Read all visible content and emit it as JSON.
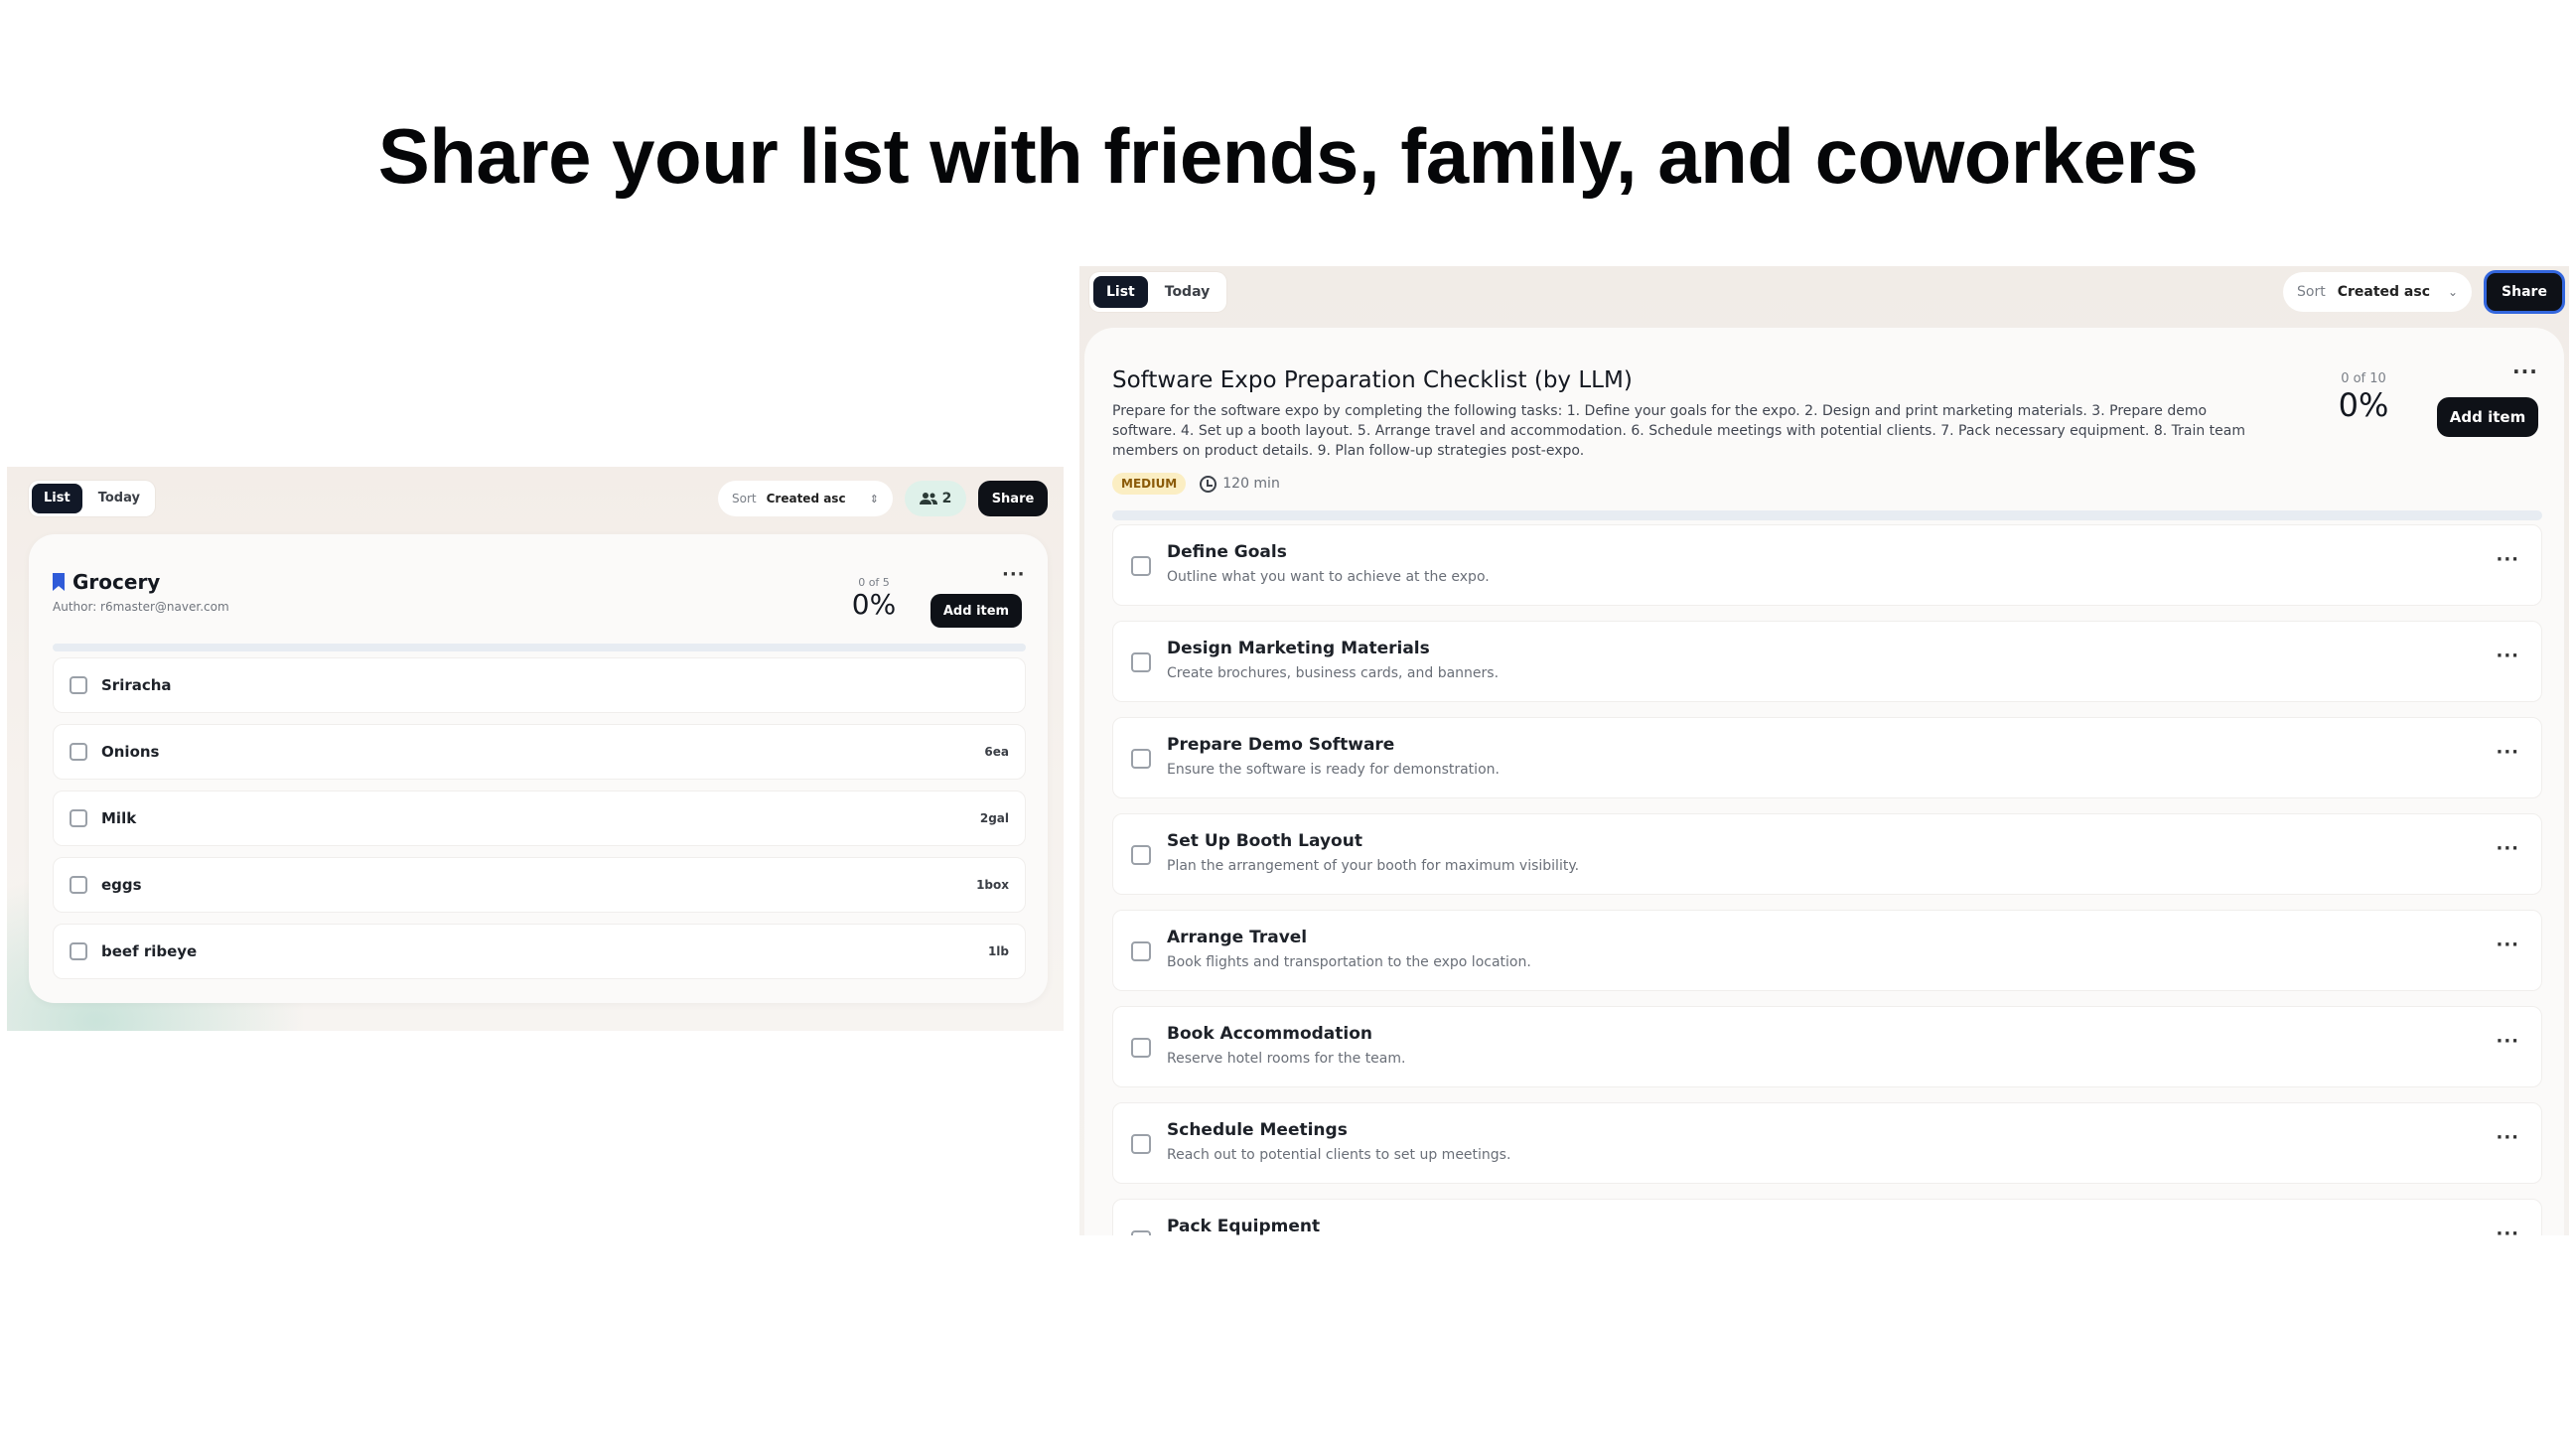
{
  "headline": "Share your list with friends, family, and coworkers",
  "left": {
    "tabs": [
      {
        "label": "List",
        "active": true
      },
      {
        "label": "Today",
        "active": false
      }
    ],
    "sort": {
      "label": "Sort",
      "value": "Created asc"
    },
    "members_count": "2",
    "share_label": "Share",
    "list": {
      "title": "Grocery",
      "author": "Author: r6master@naver.com",
      "progress_count": "0 of 5",
      "progress_percent": "0%",
      "add_item_label": "Add item",
      "more": "···",
      "items": [
        {
          "name": "Sriracha",
          "qty": ""
        },
        {
          "name": "Onions",
          "qty": "6ea"
        },
        {
          "name": "Milk",
          "qty": "2gal"
        },
        {
          "name": "eggs",
          "qty": "1box"
        },
        {
          "name": "beef ribeye",
          "qty": "1lb"
        }
      ]
    }
  },
  "right": {
    "tabs": [
      {
        "label": "List",
        "active": true
      },
      {
        "label": "Today",
        "active": false
      }
    ],
    "sort": {
      "label": "Sort",
      "value": "Created asc"
    },
    "share_label": "Share",
    "list": {
      "title": "Software Expo Preparation Checklist (by LLM)",
      "description": "Prepare for the software expo by completing the following tasks: 1. Define your goals for the expo. 2. Design and print marketing materials. 3. Prepare demo software. 4. Set up a booth layout. 5. Arrange travel and accommodation. 6. Schedule meetings with potential clients. 7. Pack necessary equipment. 8. Train team members on product details. 9. Plan follow-up strategies post-expo.",
      "priority": "MEDIUM",
      "duration": "120 min",
      "progress_count": "0 of 10",
      "progress_percent": "0%",
      "add_item_label": "Add item",
      "more": "···",
      "items": [
        {
          "name": "Define Goals",
          "note": "Outline what you want to achieve at the expo."
        },
        {
          "name": "Design Marketing Materials",
          "note": "Create brochures, business cards, and banners."
        },
        {
          "name": "Prepare Demo Software",
          "note": "Ensure the software is ready for demonstration."
        },
        {
          "name": "Set Up Booth Layout",
          "note": "Plan the arrangement of your booth for maximum visibility."
        },
        {
          "name": "Arrange Travel",
          "note": "Book flights and transportation to the expo location."
        },
        {
          "name": "Book Accommodation",
          "note": "Reserve hotel rooms for the team."
        },
        {
          "name": "Schedule Meetings",
          "note": "Reach out to potential clients to set up meetings."
        },
        {
          "name": "Pack Equipment",
          "note": ""
        }
      ]
    }
  },
  "colors": {
    "primary_button": "#0e1117",
    "accent_blue": "#3366dd",
    "badge_bg": "#fbeec3",
    "members_bg": "#dff1ea"
  },
  "icons": {
    "bookmark": "bookmark-icon",
    "members": "users-icon",
    "duration": "clock-icon",
    "sort": "chevron-updown-icon"
  }
}
